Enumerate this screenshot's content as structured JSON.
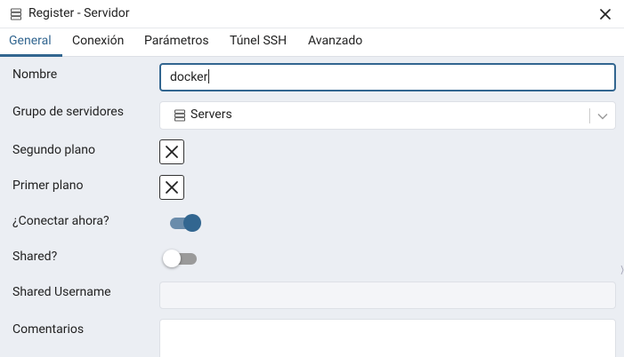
{
  "window": {
    "title": "Register - Servidor",
    "icon": "server-icon",
    "close_icon": "close-icon"
  },
  "tabs": [
    {
      "label": "General",
      "active": true
    },
    {
      "label": "Conexión",
      "active": false
    },
    {
      "label": "Parámetros",
      "active": false
    },
    {
      "label": "Túnel SSH",
      "active": false
    },
    {
      "label": "Avanzado",
      "active": false
    }
  ],
  "form": {
    "name": {
      "label": "Nombre",
      "value": "docker"
    },
    "server_group": {
      "label": "Grupo de servidores",
      "value": "Servers",
      "icon": "server-group-icon"
    },
    "background": {
      "label": "Segundo plano"
    },
    "foreground": {
      "label": "Primer plano"
    },
    "connect_now": {
      "label": "¿Conectar ahora?",
      "checked": true
    },
    "shared": {
      "label": "Shared?",
      "checked": false
    },
    "shared_username": {
      "label": "Shared Username",
      "value": ""
    },
    "comments": {
      "label": "Comentarios",
      "value": ""
    }
  },
  "colors": {
    "accent": "#326690",
    "panel_background": "#ebeef3",
    "border": "#dde0e6"
  }
}
